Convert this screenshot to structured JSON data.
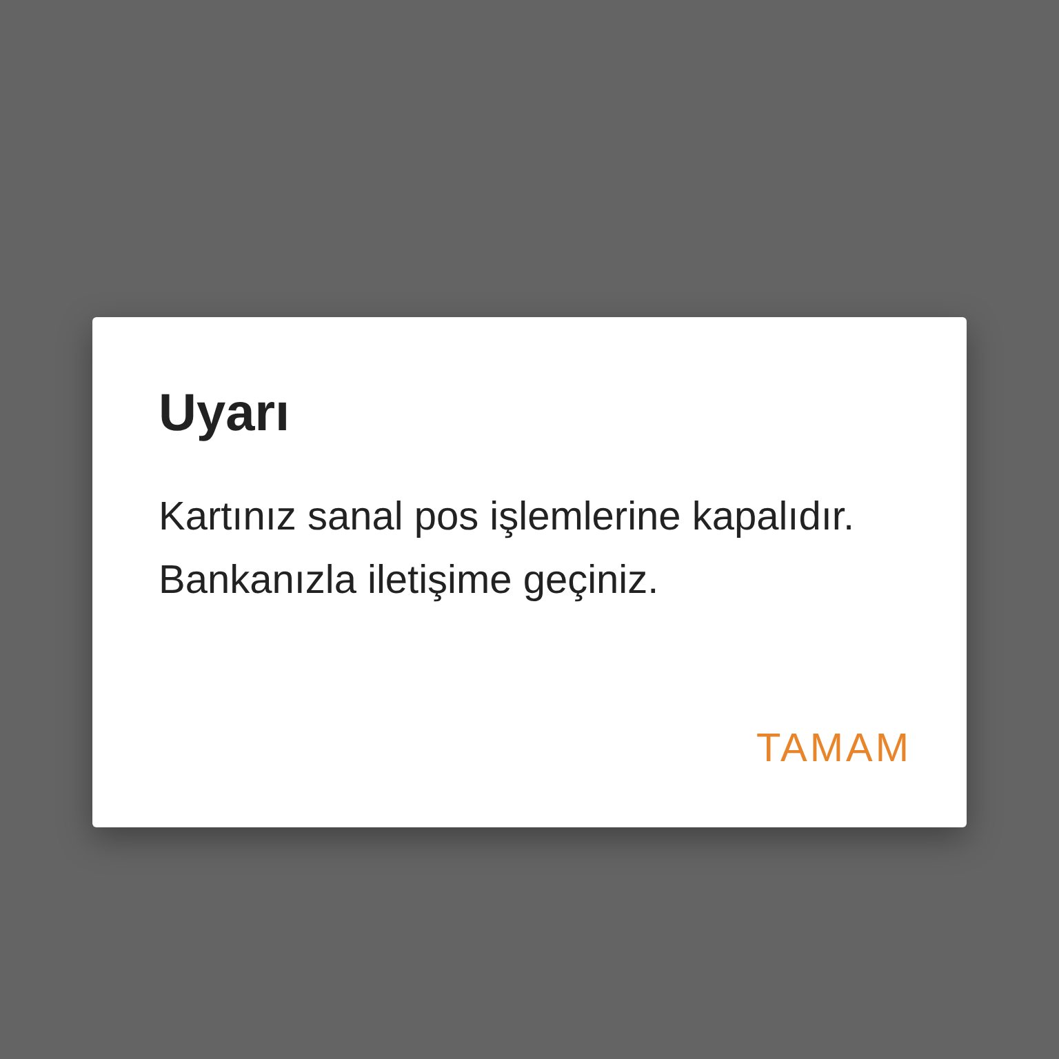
{
  "dialog": {
    "title": "Uyarı",
    "message": "Kartınız sanal pos işlemlerine kapalıdır. Bankanızla iletişime geçiniz.",
    "buttons": [
      "TAMAM"
    ]
  }
}
